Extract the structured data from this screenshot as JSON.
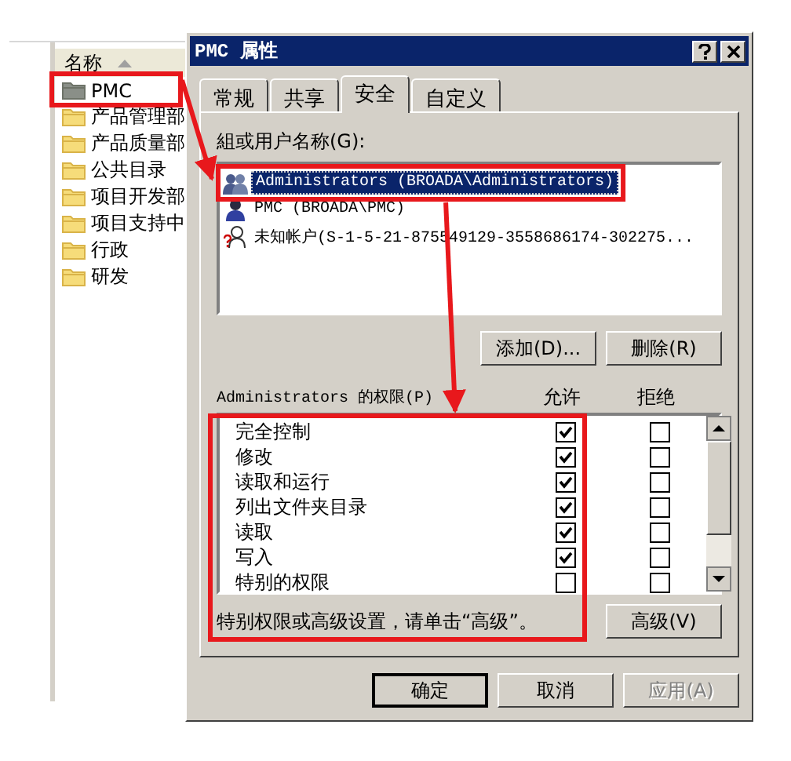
{
  "explorer": {
    "column": "名称",
    "folders": [
      {
        "name": "PMC",
        "kind": "shared"
      },
      {
        "name": "产品管理部",
        "kind": "folder"
      },
      {
        "name": "产品质量部",
        "kind": "folder"
      },
      {
        "name": "公共目录",
        "kind": "folder"
      },
      {
        "name": "项目开发部",
        "kind": "folder"
      },
      {
        "name": "项目支持中",
        "kind": "folder"
      },
      {
        "name": "行政",
        "kind": "folder"
      },
      {
        "name": "研发",
        "kind": "folder"
      }
    ]
  },
  "window": {
    "title": "PMC 属性"
  },
  "tabs": [
    {
      "label": "常规",
      "selected": false
    },
    {
      "label": "共享",
      "selected": false
    },
    {
      "label": "安全",
      "selected": true
    },
    {
      "label": "自定义",
      "selected": false
    }
  ],
  "users_label": "組或用户名称(G):",
  "users": [
    {
      "name": "Administrators (BROADA\\Administrators)",
      "kind": "group",
      "selected": true
    },
    {
      "name": "PMC (BROADA\\PMC)",
      "kind": "user",
      "selected": false
    },
    {
      "name": "未知帐户(S-1-5-21-875549129-3558686174-302275...",
      "kind": "unknown",
      "selected": false
    }
  ],
  "user_buttons": [
    "添加(D)...",
    "删除(R)"
  ],
  "permissions_label": "Administrators 的权限(P)",
  "permission_columns": [
    "允许",
    "拒绝"
  ],
  "permissions": [
    {
      "name": "完全控制",
      "allow": true,
      "deny": false
    },
    {
      "name": "修改",
      "allow": true,
      "deny": false
    },
    {
      "name": "读取和运行",
      "allow": true,
      "deny": false
    },
    {
      "name": "列出文件夹目录",
      "allow": true,
      "deny": false
    },
    {
      "name": "读取",
      "allow": true,
      "deny": false
    },
    {
      "name": "写入",
      "allow": true,
      "deny": false
    },
    {
      "name": "特别的权限",
      "allow": false,
      "deny": false
    }
  ],
  "note": "特别权限或高级设置，请单击“高级”。",
  "advanced_button": "高级(V)",
  "footer_buttons": [
    {
      "label": "确定",
      "kind": "default",
      "disabled": false
    },
    {
      "label": "取消",
      "kind": "normal",
      "disabled": false
    },
    {
      "label": "应用(A)",
      "kind": "normal",
      "disabled": true
    }
  ]
}
